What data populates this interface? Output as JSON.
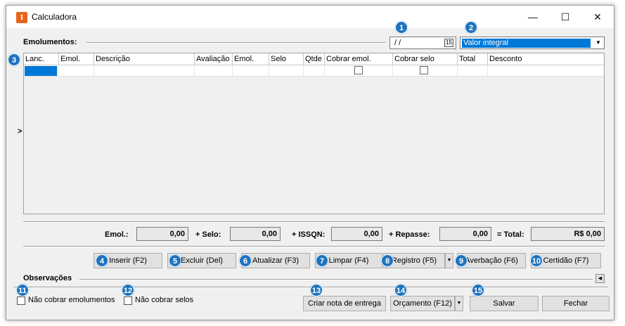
{
  "window": {
    "title": "Calculadora",
    "icon_letter": "I",
    "controls": {
      "minimize": "—",
      "maximize": "☐",
      "close": "✕"
    }
  },
  "emolumentos": {
    "label": "Emolumentos:",
    "date_value": "/ /",
    "calendar_icon_text": "15",
    "value_type": "Valor integral"
  },
  "grid": {
    "columns": [
      "Lanc.",
      "Emol.",
      "Descrição",
      "Avaliação",
      "Emol.",
      "Selo",
      "Qtde",
      "Cobrar emol.",
      "Cobrar selo",
      "Total",
      "Desconto"
    ],
    "row_indicator": ">"
  },
  "totals": {
    "emol_label": "Emol.:",
    "emol_value": "0,00",
    "selo_label": "+ Selo:",
    "selo_value": "0,00",
    "issqn_label": "+ ISSQN:",
    "issqn_value": "0,00",
    "repasse_label": "+ Repasse:",
    "repasse_value": "0,00",
    "total_label": "= Total:",
    "total_value": "R$ 0,00"
  },
  "actions": {
    "inserir": "Inserir (F2)",
    "excluir": "Excluir (Del)",
    "atualizar": "Atualizar (F3)",
    "limpar": "Limpar (F4)",
    "registro": "Registro (F5)",
    "averbacao": "Averbação (F6)",
    "certidao": "Certidão (F7)"
  },
  "observacoes": {
    "label": "Observações"
  },
  "footer": {
    "nao_cobrar_emolumentos": "Não cobrar emolumentos",
    "nao_cobrar_selos": "Não cobrar selos",
    "criar_nota": "Criar nota de entrega",
    "orcamento": "Orçamento (F12)",
    "salvar": "Salvar",
    "fechar": "Fechar"
  },
  "badges": [
    "1",
    "2",
    "3",
    "4",
    "5",
    "6",
    "7",
    "8",
    "9",
    "10",
    "11",
    "12",
    "13",
    "14",
    "15"
  ],
  "colors": {
    "accent": "#1e73be",
    "selection": "#0078d7",
    "app_icon": "#e8641c"
  }
}
